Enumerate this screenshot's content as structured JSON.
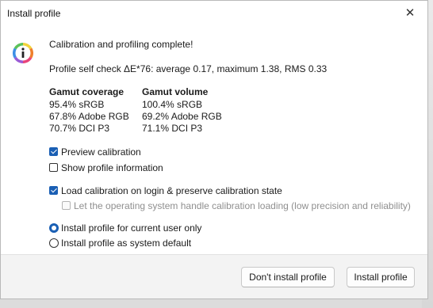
{
  "window": {
    "title": "Install profile"
  },
  "heading": "Calibration and profiling complete!",
  "self_check": "Profile self check ΔE*76: average 0.17, maximum 1.38, RMS 0.33",
  "gamut": {
    "coverage": {
      "header": "Gamut coverage",
      "rows": [
        "95.4% sRGB",
        "67.8% Adobe RGB",
        "70.7% DCI P3"
      ]
    },
    "volume": {
      "header": "Gamut volume",
      "rows": [
        "100.4% sRGB",
        "69.2% Adobe RGB",
        "71.1% DCI P3"
      ]
    }
  },
  "options": {
    "preview_calibration": {
      "label": "Preview calibration",
      "checked": true
    },
    "show_profile_info": {
      "label": "Show profile information",
      "checked": false
    },
    "load_calibration": {
      "label": "Load calibration on login & preserve calibration state",
      "checked": true
    },
    "os_handle": {
      "label": "Let the operating system handle calibration loading (low precision and reliability)",
      "checked": false,
      "disabled": true
    }
  },
  "install_scope": {
    "current_user": {
      "label": "Install profile for current user only",
      "selected": true
    },
    "system_default": {
      "label": "Install profile as system default",
      "selected": false
    }
  },
  "buttons": {
    "dont_install": "Don't install profile",
    "install": "Install profile"
  },
  "colors": {
    "accent": "#1a5fb4",
    "disabled_text": "#8f8f8f"
  },
  "icons": {
    "info": "info-icon",
    "close": "close-icon"
  }
}
